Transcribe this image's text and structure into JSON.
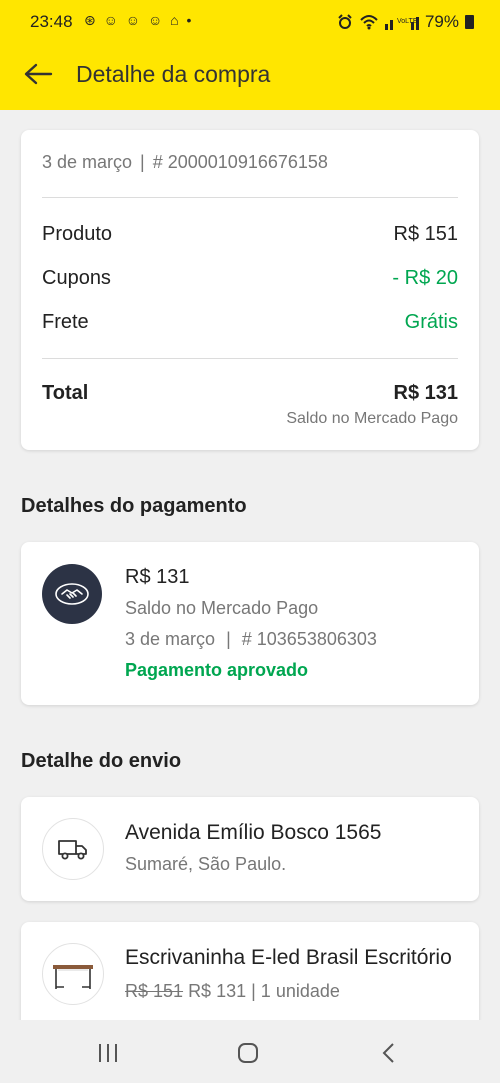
{
  "status_bar": {
    "time": "23:48",
    "notifications": "⊛ ☺ ☺ ☺ ⌂ •",
    "battery": "79%"
  },
  "header": {
    "title": "Detalhe da compra",
    "back_icon": "arrow-left-icon",
    "background": "#ffe600"
  },
  "summary": {
    "date": "3 de março",
    "separator": "|",
    "order_number": "# 2000010916676158",
    "rows": [
      {
        "label": "Produto",
        "value": "R$ 151"
      },
      {
        "label": "Cupons",
        "value": "- R$ 20"
      },
      {
        "label": "Frete",
        "value": "Grátis"
      }
    ],
    "total_label": "Total",
    "total_value": "R$ 131",
    "total_method": "Saldo no Mercado Pago"
  },
  "payment": {
    "section_title": "Detalhes do pagamento",
    "icon": "handshake-icon",
    "amount": "R$ 131",
    "method": "Saldo no Mercado Pago",
    "date": "3 de março",
    "separator": "|",
    "payment_id": "# 103653806303",
    "status": "Pagamento aprovado"
  },
  "shipping": {
    "section_title": "Detalhe do envio",
    "icon": "truck-icon",
    "address": "Avenida Emílio Bosco 1565",
    "city": "Sumaré, São Paulo."
  },
  "item": {
    "icon": "desk-thumbnail",
    "name": "Escrivaninha E-led Brasil Escritório",
    "old_price": "R$ 151",
    "price": "R$ 131",
    "quantity": "| 1 unidade"
  },
  "colors": {
    "accent": "#ffe600",
    "success": "#00a650",
    "avatar_bg": "#2c3345"
  }
}
